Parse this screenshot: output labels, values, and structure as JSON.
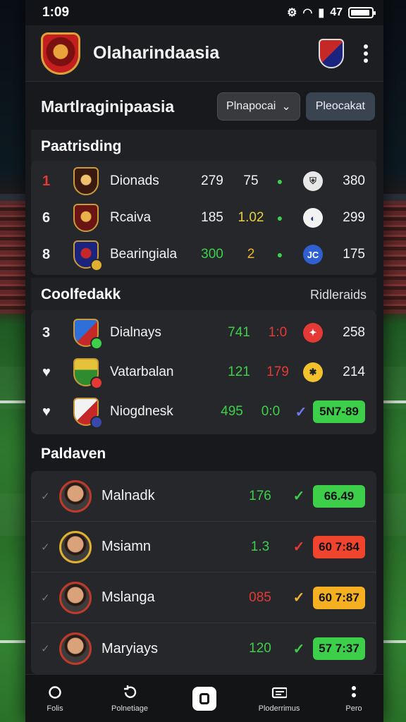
{
  "status_bar": {
    "time": "1:09",
    "battery_text": "47"
  },
  "app": {
    "title": "Olaharindaasia"
  },
  "toolbar": {
    "heading": "Martlraginipaasia",
    "dropdown_label": "Plnapocai",
    "action_label": "Pleocakat"
  },
  "section1": {
    "title": "Paatrisding",
    "rows": [
      {
        "rank": "1",
        "team": "Dionads",
        "v1": "279",
        "v2": "75",
        "score": "380",
        "v2_color": "#ffffff"
      },
      {
        "rank": "6",
        "team": "Rcaiva",
        "v1": "185",
        "v2": "1.02",
        "score": "299",
        "v2_color": "#e6d13a"
      },
      {
        "rank": "8",
        "team": "Bearingiala",
        "v1": "300",
        "v2": "2",
        "score": "175",
        "v1_color": "#3ecf4a",
        "v2_color": "#f2b233"
      }
    ]
  },
  "section2": {
    "title": "Coolfedakk",
    "right_label": "Ridleraids",
    "rows": [
      {
        "rank": "3",
        "team": "Dialnays",
        "v1": "741",
        "v2": "1:0",
        "score": "258",
        "v1_color": "#3ecf4a",
        "v2_color": "#e53935"
      },
      {
        "rank": "♥",
        "team": "Vatarbalan",
        "v1": "121",
        "v2": "179",
        "score": "214",
        "v1_color": "#3ecf4a",
        "v2_color": "#e53935"
      },
      {
        "rank": "♥",
        "team": "Niogdnesk",
        "v1": "495",
        "v2": "0:0",
        "pill": "5N7-89",
        "v1_color": "#3ecf4a",
        "v2_color": "#3ecf4a",
        "pill_color": "#3ecf4a"
      }
    ]
  },
  "section3": {
    "title": "Paldaven",
    "rows": [
      {
        "name": "Malnadk",
        "value": "176",
        "value_color": "#3ecf4a",
        "tick_color": "#3ecf4a",
        "pill": "66.49",
        "pill_color": "#3ecf4a"
      },
      {
        "name": "Msiamn",
        "value": "1.3",
        "value_color": "#3ecf4a",
        "tick_color": "#e53935",
        "pill": "60 7:84",
        "pill_color": "#f0442f"
      },
      {
        "name": "Mslanga",
        "value": "085",
        "value_color": "#e53935",
        "tick_color": "#f2b233",
        "pill": "60 7:87",
        "pill_color": "#f4b020"
      },
      {
        "name": "Maryiays",
        "value": "120",
        "value_color": "#3ecf4a",
        "tick_color": "#3ecf4a",
        "pill": "57 7:37",
        "pill_color": "#3ecf4a"
      }
    ]
  },
  "bottom_nav": [
    {
      "label": "Folis",
      "icon": "circle-icon"
    },
    {
      "label": "Polnetiage",
      "icon": "refresh-icon"
    },
    {
      "label": "",
      "icon": "home-icon"
    },
    {
      "label": "Ploderrimus",
      "icon": "ticket-icon"
    },
    {
      "label": "Pero",
      "icon": "more-icon"
    }
  ]
}
